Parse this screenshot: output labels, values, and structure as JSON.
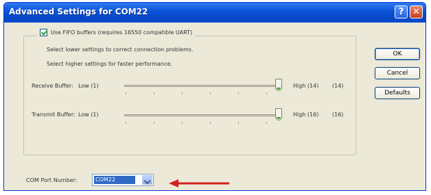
{
  "window": {
    "title": "Advanced Settings for COM22",
    "help_glyph": "?",
    "close_glyph": "✕",
    "titlebar_color": "#0a53d9"
  },
  "fifo": {
    "checked": true,
    "label": "Use FIFO buffers (requires 16550 compatible UART)",
    "hint_lower": "Select lower settings to correct connection problems.",
    "hint_higher": "Select higher settings for faster performance."
  },
  "receive": {
    "label": "Receive Buffer:",
    "low_label": "Low (1)",
    "high_label": "High (14)",
    "value_label": "(14)",
    "level_fraction": 1.0
  },
  "transmit": {
    "label": "Transmit Buffer:",
    "low_label": "Low (1)",
    "high_label": "High (16)",
    "value_label": "(16)",
    "level_fraction": 1.0
  },
  "buttons": {
    "ok": "OK",
    "cancel": "Cancel",
    "defaults": "Defaults"
  },
  "com_port": {
    "label": "COM Port Number:",
    "value": "COM22"
  },
  "annotation": {
    "arrow_color": "#d32020"
  }
}
